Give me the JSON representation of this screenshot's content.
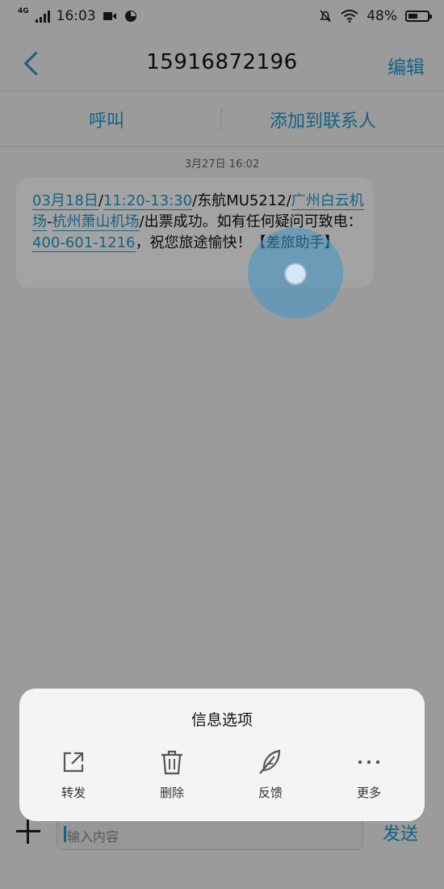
{
  "status_bar": {
    "network": "4G",
    "time": "16:03",
    "battery_percent_text": "48%",
    "battery_level": 0.48
  },
  "nav": {
    "title": "15916872196",
    "edit_label": "编辑"
  },
  "actions": {
    "call_label": "呼叫",
    "add_contact_label": "添加到联系人"
  },
  "timestamp": "3月27日 16:02",
  "message": {
    "date_link": "03月18日",
    "time_link": "11:20-13:30",
    "flight_text": "/东航MU5212/",
    "from_airport_link": "广州白云机场",
    "to_airport_link": "杭州萧山机场",
    "ticket_text": "/出票成功。如有任何疑问可致电：",
    "phone_link": "400-601-1216",
    "closing_text": "，祝您旅途愉快！【差旅助手】"
  },
  "options_sheet": {
    "title": "信息选项",
    "items": [
      {
        "label": "转发",
        "icon": "share-icon"
      },
      {
        "label": "删除",
        "icon": "trash-icon"
      },
      {
        "label": "反馈",
        "icon": "feather-icon"
      },
      {
        "label": "更多",
        "icon": "more-icon"
      }
    ]
  },
  "composer": {
    "placeholder": "输入内容",
    "send_label": "发送"
  },
  "colors": {
    "accent": "#1e9bd0",
    "overlay": "rgba(0,0,0,0.36)"
  }
}
